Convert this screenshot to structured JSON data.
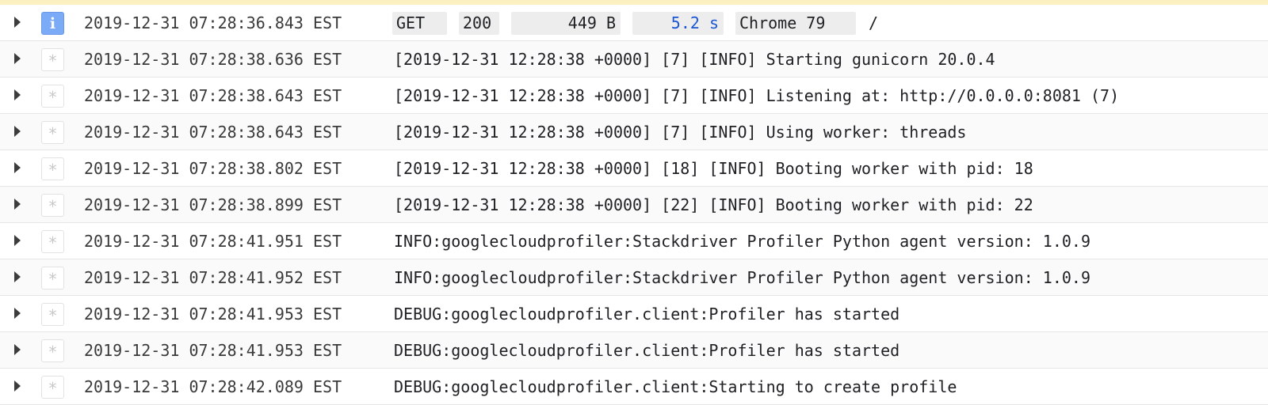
{
  "log": {
    "request": {
      "timestamp": "2019-12-31 07:28:36.843 EST",
      "severity_icon": "info-icon",
      "method": "GET",
      "status": "200",
      "size": "449 B",
      "latency": "5.2 s",
      "user_agent": "Chrome 79",
      "path": "/"
    },
    "entries": [
      {
        "timestamp": "2019-12-31 07:28:38.636 EST",
        "message": "[2019-12-31 12:28:38 +0000] [7] [INFO] Starting gunicorn 20.0.4"
      },
      {
        "timestamp": "2019-12-31 07:28:38.643 EST",
        "message": "[2019-12-31 12:28:38 +0000] [7] [INFO] Listening at: http://0.0.0.0:8081 (7)"
      },
      {
        "timestamp": "2019-12-31 07:28:38.643 EST",
        "message": "[2019-12-31 12:28:38 +0000] [7] [INFO] Using worker: threads"
      },
      {
        "timestamp": "2019-12-31 07:28:38.802 EST",
        "message": "[2019-12-31 12:28:38 +0000] [18] [INFO] Booting worker with pid: 18"
      },
      {
        "timestamp": "2019-12-31 07:28:38.899 EST",
        "message": "[2019-12-31 12:28:38 +0000] [22] [INFO] Booting worker with pid: 22"
      },
      {
        "timestamp": "2019-12-31 07:28:41.951 EST",
        "message": "INFO:googlecloudprofiler:Stackdriver Profiler Python agent version: 1.0.9"
      },
      {
        "timestamp": "2019-12-31 07:28:41.952 EST",
        "message": "INFO:googlecloudprofiler:Stackdriver Profiler Python agent version: 1.0.9"
      },
      {
        "timestamp": "2019-12-31 07:28:41.953 EST",
        "message": "DEBUG:googlecloudprofiler.client:Profiler has started"
      },
      {
        "timestamp": "2019-12-31 07:28:41.953 EST",
        "message": "DEBUG:googlecloudprofiler.client:Profiler has started"
      },
      {
        "timestamp": "2019-12-31 07:28:42.089 EST",
        "message": "DEBUG:googlecloudprofiler.client:Starting to create profile"
      }
    ],
    "default_severity_glyph": "*",
    "info_severity_glyph": "i"
  },
  "colors": {
    "info_badge": "#7baaf7",
    "latency_text": "#1a56d6",
    "chip_bg": "#ededed",
    "top_banner": "#fbf0c2"
  }
}
